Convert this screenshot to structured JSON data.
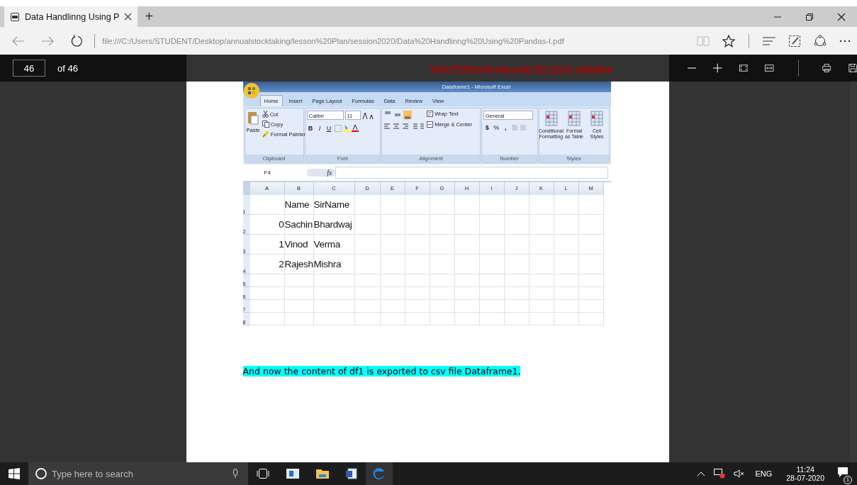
{
  "browser": {
    "tabs": [
      {
        "title": "Data Handlinng Using P",
        "selected": true
      }
    ],
    "new_tab": "+",
    "address": "file:///C:/Users/STUDENT/Desktop/annualstocktaking/lesson%20Plan/session2020/Data%20Handlinng%20Using%20Pandas-I.pdf"
  },
  "pdf_toolbar": {
    "page": "46",
    "page_count": "of 46",
    "banner": "Visit Python4csip.com for more updates"
  },
  "excel": {
    "title": "Dataframe1 - Microsoft Excel",
    "tabs": [
      {
        "label": "Home",
        "selected": true
      },
      {
        "label": "Insert",
        "selected": false
      },
      {
        "label": "Page Layout",
        "selected": false
      },
      {
        "label": "Formulas",
        "selected": false
      },
      {
        "label": "Data",
        "selected": false
      },
      {
        "label": "Review",
        "selected": false
      },
      {
        "label": "View",
        "selected": false
      }
    ],
    "clipboard": {
      "paste": "Paste",
      "cut": "Cut",
      "copy": "Copy",
      "format_painter": "Format Painter",
      "label": "Clipboard"
    },
    "font": {
      "name": "Calibri",
      "size": "11",
      "bold": "B",
      "italic": "I",
      "underline": "U",
      "label": "Font"
    },
    "alignment": {
      "wrap_text": "Wrap Text",
      "merge_center": "Merge & Center",
      "label": "Alignment"
    },
    "number": {
      "format": "General",
      "currency": "$",
      "percent": "%",
      "comma": ",",
      "label": "Number"
    },
    "styles": {
      "buttons": [
        "Conditional Formatting",
        "Format as Table",
        "Cell Styles"
      ],
      "label": "Styles"
    },
    "name_box": "F4",
    "fx": "fx",
    "columns": [
      "A",
      "B",
      "C",
      "D",
      "E",
      "F",
      "G",
      "H",
      "I",
      "J",
      "K",
      "L",
      "M"
    ],
    "rows": [
      {
        "number": "1",
        "name": "Name",
        "sir_name": "SirName"
      },
      {
        "number": "2",
        "index": "0",
        "name": "Sachin",
        "sir_name": "Bhardwaj"
      },
      {
        "number": "3",
        "index": "1",
        "name": "Vinod",
        "sir_name": "Verma"
      },
      {
        "number": "4",
        "index": "2",
        "name": "Rajesh",
        "sir_name": "Mishra"
      },
      {
        "number": "5"
      },
      {
        "number": "6"
      },
      {
        "number": "7"
      },
      {
        "number": "8"
      }
    ]
  },
  "caption": "And now the content of df1 is exported to csv file Dataframe1.",
  "taskbar": {
    "search_placeholder": "Type here to search",
    "language": "ENG",
    "time": "11:24",
    "date": "28-07-2020",
    "notification_count": "1"
  }
}
